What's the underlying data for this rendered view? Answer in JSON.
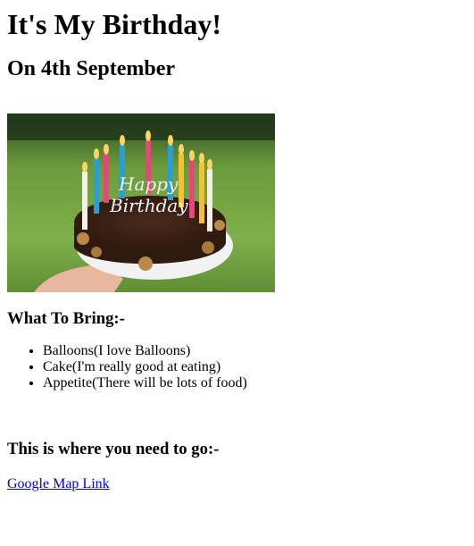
{
  "page": {
    "title": "It's My Birthday!",
    "subtitle": "On 4th September",
    "image": {
      "name": "birthday-cake-photo",
      "cake_text": [
        "Happy",
        "Birthday"
      ]
    },
    "bring_heading": "What To Bring:-",
    "bring_items": [
      "Balloons(I love Balloons)",
      "Cake(I'm really good at eating)",
      "Appetite(There will be lots of food)"
    ],
    "go_heading": "This is where you need to go:-",
    "map_link": "Google Map Link"
  },
  "colors": {
    "link": "#0000ee",
    "text": "#000000"
  }
}
